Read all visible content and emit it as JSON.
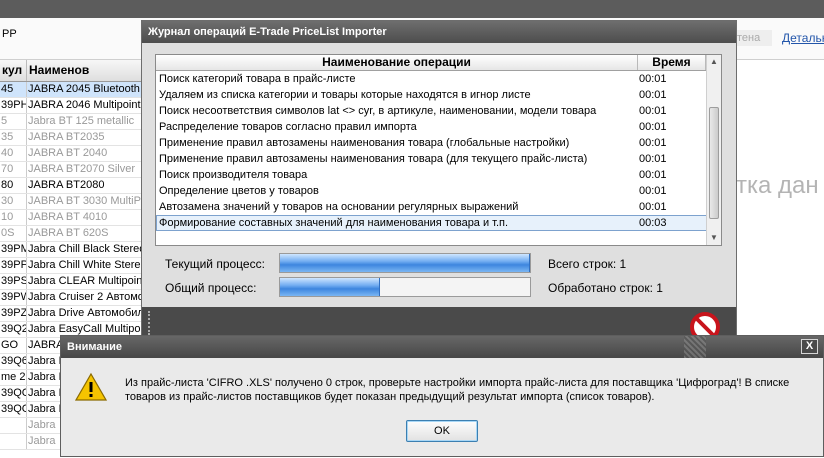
{
  "background": {
    "header_label": "PP",
    "search_placeholder": "тена",
    "details_link": "Детальн",
    "right_text": "тка дан",
    "grid": {
      "columns": [
        "кул",
        "Наименов"
      ],
      "rows": [
        {
          "code": "45",
          "name": "JABRA 2045 Bluetooth n",
          "style": "sel"
        },
        {
          "code": "39PH7",
          "name": "JABRA 2046 Multipoint",
          "style": ""
        },
        {
          "code": "5",
          "name": "Jabra BT 125 metallic",
          "style": "grey"
        },
        {
          "code": "35",
          "name": "JABRA BT2035",
          "style": "grey"
        },
        {
          "code": "40",
          "name": "JABRA BT 2040",
          "style": "grey"
        },
        {
          "code": "70",
          "name": "JABRA BT2070 Silver",
          "style": "grey"
        },
        {
          "code": "80",
          "name": "JABRA BT2080",
          "style": ""
        },
        {
          "code": "30",
          "name": "JABRA BT 3030 MultiPoin",
          "style": "grey"
        },
        {
          "code": "10",
          "name": "JABRA BT 4010",
          "style": "grey"
        },
        {
          "code": "0S",
          "name": "JABRA BT 620S",
          "style": "grey"
        },
        {
          "code": "39PM3",
          "name": "Jabra Chill Black Stereo",
          "style": ""
        },
        {
          "code": "39PPD",
          "name": "Jabra Chill White Stereo",
          "style": ""
        },
        {
          "code": "39PSP",
          "name": "Jabra CLEAR Multipoint",
          "style": ""
        },
        {
          "code": "39PW",
          "name": "Jabra Cruiser 2 Автомо",
          "style": ""
        },
        {
          "code": "39PZD",
          "name": "Jabra Drive Автомобил",
          "style": ""
        },
        {
          "code": "39Q2N",
          "name": "Jabra EasyCall Multipoin",
          "style": ""
        },
        {
          "code": "GO",
          "name": "JABRA",
          "style": ""
        },
        {
          "code": "39Q63",
          "name": "Jabra E",
          "style": ""
        },
        {
          "code": "me 2",
          "name": "Jabra E",
          "style": ""
        },
        {
          "code": "39QC",
          "name": "Jabra E",
          "style": ""
        },
        {
          "code": "39QG",
          "name": "Jabra H",
          "style": ""
        },
        {
          "code": "",
          "name": "Jabra",
          "style": "grey"
        },
        {
          "code": "",
          "name": "Jabra",
          "style": "grey"
        }
      ]
    }
  },
  "journal": {
    "title": "Журнал операций E-Trade PriceList Importer",
    "columns": {
      "operation": "Наименование операции",
      "time": "Время"
    },
    "operations": [
      {
        "name": "Поиск категорий товара в прайс-листе",
        "time": "00:01"
      },
      {
        "name": "Удаляем из списка категории и товары которые находятся в игнор листе",
        "time": "00:01"
      },
      {
        "name": "Поиск несоответствия символов lat <> cyr, в артикуле, наименовании, модели товара",
        "time": "00:01"
      },
      {
        "name": "Распределение товаров согласно правил импорта",
        "time": "00:01"
      },
      {
        "name": "Применение правил автозамены наименования товара (глобальные настройки)",
        "time": "00:01"
      },
      {
        "name": "Применение правил автозамены наименования товара (для текущего прайс-листа)",
        "time": "00:01"
      },
      {
        "name": "Поиск производителя товара",
        "time": "00:01"
      },
      {
        "name": "Определение цветов у товаров",
        "time": "00:01"
      },
      {
        "name": "Автозамена значений у товаров на основании регулярных выражений",
        "time": "00:01"
      },
      {
        "name": "Формирование составных значений для наименования товара и т.п.",
        "time": "00:03",
        "selected": true
      }
    ],
    "current_process_label": "Текущий процесс:",
    "overall_process_label": "Общий процесс:",
    "current_progress": 1.0,
    "overall_progress": 0.4,
    "total_rows_text": "Всего строк: 1",
    "processed_rows_text": "Обработано строк: 1"
  },
  "dialog": {
    "title": "Внимание",
    "close_label": "X",
    "message": "Из прайс-листа 'CIFRO          .XLS' получено 0 строк, проверьте настройки импорта прайс-листа для поставщика 'Цифроград'! В списке\nтоваров из прайс-листов поставщиков будет показан предыдущий результат импорта (список товаров).",
    "ok_label": "OK"
  },
  "colors": {
    "progress": "#3d86df",
    "title_bar": "#555555",
    "selection": "#e7f1fb",
    "warning": "#f5c400"
  }
}
